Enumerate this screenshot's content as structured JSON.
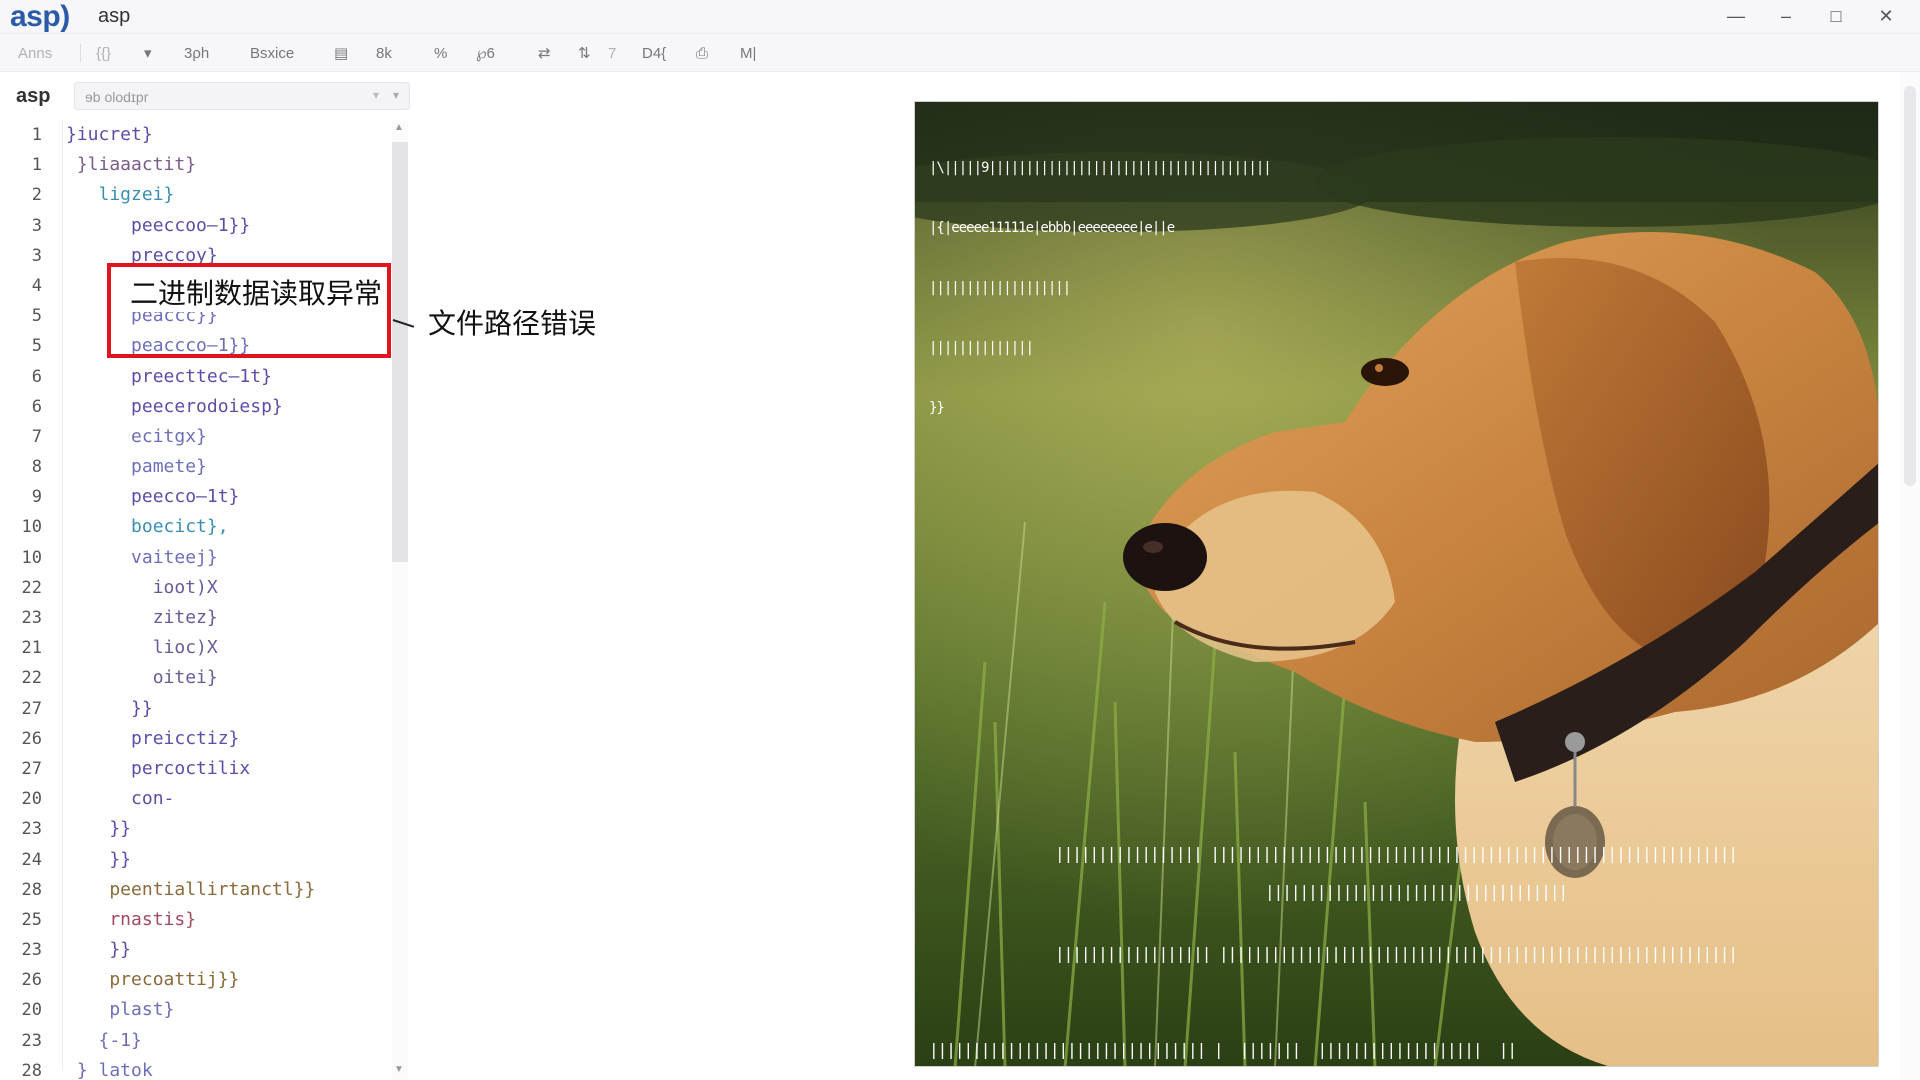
{
  "app": {
    "logo": "asp)",
    "window_title": "asp"
  },
  "window_controls": {
    "minimize": "—",
    "restore": "–",
    "maximize": "□",
    "close": "✕"
  },
  "toolbar": {
    "items": [
      "Anns",
      "{{}",
      "▾",
      "3ρh",
      "Bsxice",
      "▤",
      "8k",
      "%",
      "℘6",
      "⇄",
      "⇅",
      "7",
      "D4{",
      "⎙",
      "M|"
    ]
  },
  "editor": {
    "lang_label": "asp",
    "selector_text": "ɘb olodɪpr",
    "line_numbers": [
      "1",
      "1",
      "2",
      "3",
      "3",
      "4",
      "5",
      "5",
      "6",
      "6",
      "7",
      "8",
      "9",
      "10",
      "10",
      "22",
      "23",
      "21",
      "22",
      "27",
      "26",
      "27",
      "20",
      "23",
      "24",
      "28",
      "25",
      "23",
      "26",
      "20",
      "23",
      "28"
    ],
    "lines": [
      "}iucret}",
      " }liaaactit}",
      "   ligzei}",
      "      peeccoo—1}}",
      "      preccoy}",
      "      pea̤ccc}}",
      "      peaccc}}",
      "      peaccco—1}}",
      "      preecttec—1t}",
      "      peecerodoiesp}",
      "      ecitgx}",
      "      pamete}",
      "      peecco—1t}",
      "      boecict},",
      "      vaiteej}",
      "        ioot)X",
      "        zitez}",
      "        lioc)X",
      "        oitei}",
      "      }}",
      "      preicctiz}",
      "      percoctilix",
      "      con-",
      "    }}",
      "    }}",
      "    peentiallirtanctl}}",
      "    rnastis}",
      "    }}",
      "    precoattij}}",
      "    plast}",
      "   {-1}",
      " } latok"
    ]
  },
  "annotation": {
    "box_title": "二进制数据读取异常",
    "label": "文件路径错误"
  },
  "image_panel": {
    "icon": "dog-photo",
    "overlay_text_lines": [
      "|\\|||||9||||||||||||||||||||||||||||||||||||||",
      "|{|eeeee11111e|ebbb|eeeeeeee|e||e",
      "|||||||||||||||||||",
      "||||||||||||||",
      "}}"
    ],
    "bottom_bars": [
      "||||||||||||||||| |||||||||||||||||||||||||||||||||||||||||||||||||||||||||||||",
      "|||||||||||||||||||||||||||||||||||",
      "|||||||||||||||||| ||||||||||||||||||||||||||||||||||||||||||||||||||||||||||||",
      "|||||||||||||||||||||||||||||||| |  |||||||  |||||||||||||||||||  ||"
    ]
  }
}
